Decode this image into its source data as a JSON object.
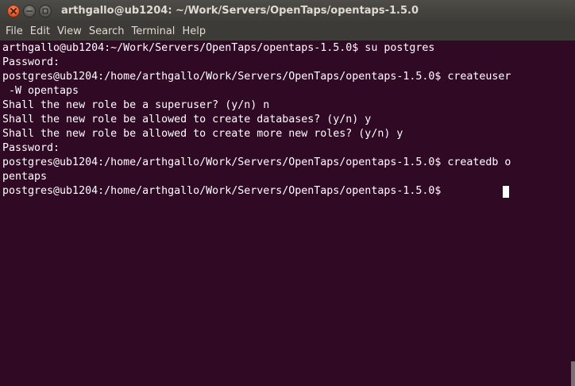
{
  "window": {
    "title": "arthgallo@ub1204: ~/Work/Servers/OpenTaps/opentaps-1.5.0"
  },
  "menu": {
    "items": [
      "File",
      "Edit",
      "View",
      "Search",
      "Terminal",
      "Help"
    ]
  },
  "terminal": {
    "lines": [
      "arthgallo@ub1204:~/Work/Servers/OpenTaps/opentaps-1.5.0$ su postgres",
      "Password:",
      "postgres@ub1204:/home/arthgallo/Work/Servers/OpenTaps/opentaps-1.5.0$ createuser",
      " -W opentaps",
      "Shall the new role be a superuser? (y/n) n",
      "Shall the new role be allowed to create databases? (y/n) y",
      "Shall the new role be allowed to create more new roles? (y/n) y",
      "Password:",
      "postgres@ub1204:/home/arthgallo/Work/Servers/OpenTaps/opentaps-1.5.0$ createdb o",
      "pentaps",
      "postgres@ub1204:/home/arthgallo/Work/Servers/OpenTaps/opentaps-1.5.0$ "
    ]
  },
  "colors": {
    "terminal_background": "#300a24",
    "terminal_text": "#ffffff",
    "titlebar": "#3c3b37",
    "close_button": "#e05a2b"
  },
  "icons": {
    "close": "close-icon",
    "minimize": "minimize-icon",
    "maximize": "maximize-icon"
  }
}
